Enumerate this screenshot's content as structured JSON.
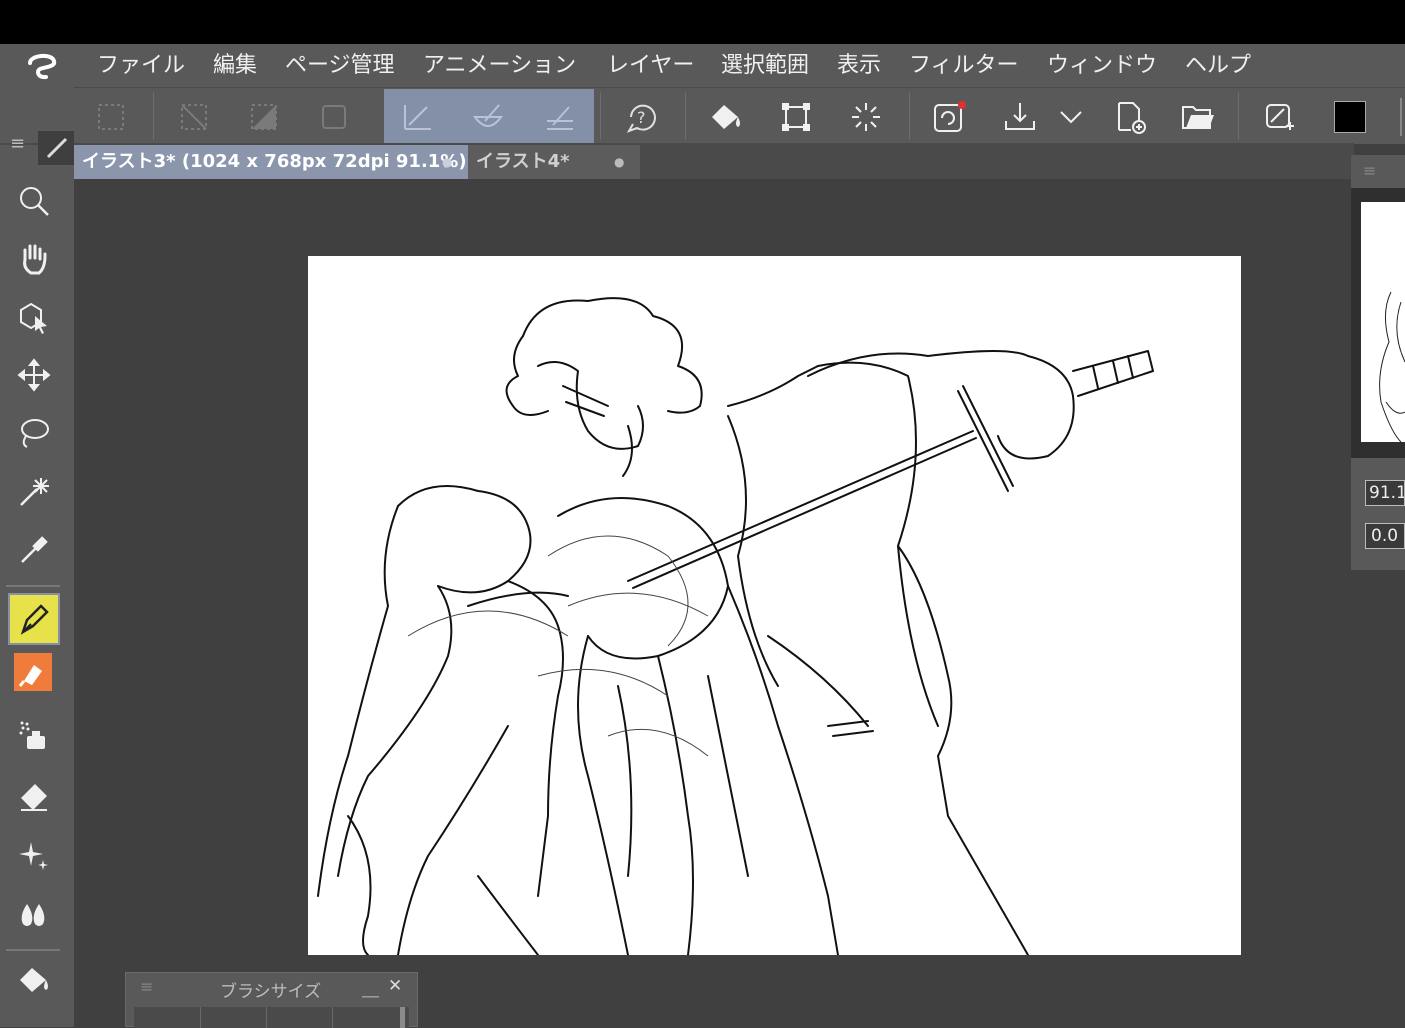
{
  "app": {
    "logo": "clip-studio-logo"
  },
  "menu": [
    {
      "label": "ファイル"
    },
    {
      "label": "編集"
    },
    {
      "label": "ページ管理"
    },
    {
      "label": "アニメーション"
    },
    {
      "label": "レイヤー"
    },
    {
      "label": "選択範囲"
    },
    {
      "label": "表示"
    },
    {
      "label": "フィルター"
    },
    {
      "label": "ウィンドウ"
    },
    {
      "label": "ヘルプ"
    }
  ],
  "toolbar": {
    "icons": [
      "select-show-icon",
      "deselect-icon",
      "invert-selection-icon",
      "selection-border-icon",
      "reference-layer-icon",
      "pen-pressure-icon",
      "stabilization-icon",
      "help-icon",
      "fill-icon",
      "transform-icon",
      "loading-icon",
      "clip-studio-share-icon",
      "export-icon",
      "chevron-down-icon",
      "new-file-icon",
      "open-folder-icon",
      "snap-icon"
    ],
    "active_group": [
      "reference-layer-icon",
      "pen-pressure-icon",
      "stabilization-icon"
    ],
    "main_color": "#000000"
  },
  "tools": {
    "icons": [
      "zoom-icon",
      "hand-icon",
      "object-select-icon",
      "move-icon",
      "lasso-icon",
      "auto-select-icon",
      "eyedropper-icon",
      "pen-icon",
      "marker-icon",
      "airbrush-icon",
      "eraser-icon",
      "decoration-icon",
      "blend-icon",
      "fill-icon"
    ],
    "active": "pen-icon",
    "active_color": "#e8e24a",
    "marker_color": "#f07c3c"
  },
  "tabs": [
    {
      "label": "イラスト3* (1024 x 768px 72dpi 91.1%)",
      "dot": "●",
      "active": true
    },
    {
      "label": "イラスト4*",
      "dot": "●",
      "active": false
    }
  ],
  "navigator": {
    "zoom_value": "91.1",
    "rotation_value": "0.0"
  },
  "brush_panel": {
    "title": "ブラシサイズ",
    "minimize": "＿",
    "close": "✕"
  }
}
